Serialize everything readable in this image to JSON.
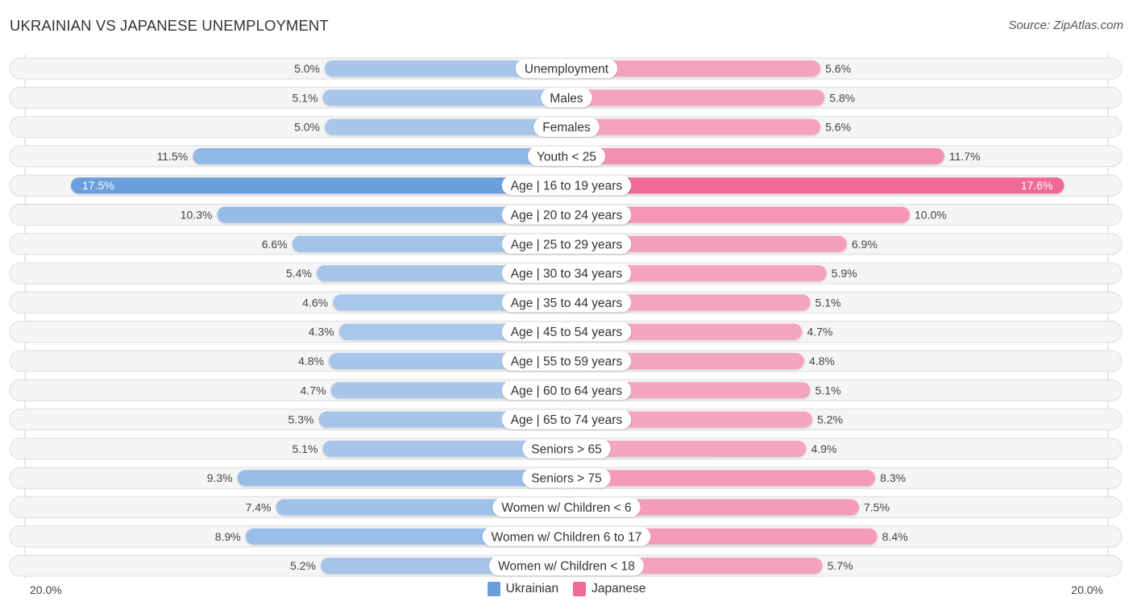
{
  "header": {
    "title": "UKRAINIAN VS JAPANESE UNEMPLOYMENT",
    "source": "Source: ZipAtlas.com"
  },
  "colors": {
    "ukrainian": "#6a9fdc",
    "ukrainian_light": "#a9c7ea",
    "japanese": "#f06a95",
    "japanese_light": "#f5a7c0"
  },
  "chart_data": {
    "type": "bar",
    "orientation": "horizontal-diverging",
    "title": "UKRAINIAN VS JAPANESE UNEMPLOYMENT",
    "xlabel": "",
    "ylabel": "",
    "xlim": [
      0,
      20.0
    ],
    "axis_min_label": "20.0%",
    "axis_max_label": "20.0%",
    "legend_position": "bottom-center",
    "categories": [
      "Unemployment",
      "Males",
      "Females",
      "Youth < 25",
      "Age | 16 to 19 years",
      "Age | 20 to 24 years",
      "Age | 25 to 29 years",
      "Age | 30 to 34 years",
      "Age | 35 to 44 years",
      "Age | 45 to 54 years",
      "Age | 55 to 59 years",
      "Age | 60 to 64 years",
      "Age | 65 to 74 years",
      "Seniors > 65",
      "Seniors > 75",
      "Women w/ Children < 6",
      "Women w/ Children 6 to 17",
      "Women w/ Children < 18"
    ],
    "series": [
      {
        "name": "Ukrainian",
        "side": "left",
        "values": [
          5.0,
          5.1,
          5.0,
          11.5,
          17.5,
          10.3,
          6.6,
          5.4,
          4.6,
          4.3,
          4.8,
          4.7,
          5.3,
          5.1,
          9.3,
          7.4,
          8.9,
          5.2
        ],
        "labels": [
          "5.0%",
          "5.1%",
          "5.0%",
          "11.5%",
          "17.5%",
          "10.3%",
          "6.6%",
          "5.4%",
          "4.6%",
          "4.3%",
          "4.8%",
          "4.7%",
          "5.3%",
          "5.1%",
          "9.3%",
          "7.4%",
          "8.9%",
          "5.2%"
        ]
      },
      {
        "name": "Japanese",
        "side": "right",
        "values": [
          5.6,
          5.8,
          5.6,
          11.7,
          17.6,
          10.0,
          6.9,
          5.9,
          5.1,
          4.7,
          4.8,
          5.1,
          5.2,
          4.9,
          8.3,
          7.5,
          8.4,
          5.7
        ],
        "labels": [
          "5.6%",
          "5.8%",
          "5.6%",
          "11.7%",
          "17.6%",
          "10.0%",
          "6.9%",
          "5.9%",
          "5.1%",
          "4.7%",
          "4.8%",
          "5.1%",
          "5.2%",
          "4.9%",
          "8.3%",
          "7.5%",
          "8.4%",
          "5.7%"
        ]
      }
    ]
  },
  "axis": {
    "left_label": "20.0%",
    "right_label": "20.0%"
  },
  "legend": [
    {
      "name": "Ukrainian",
      "color": "#6a9fdc"
    },
    {
      "name": "Japanese",
      "color": "#f06a95"
    }
  ]
}
